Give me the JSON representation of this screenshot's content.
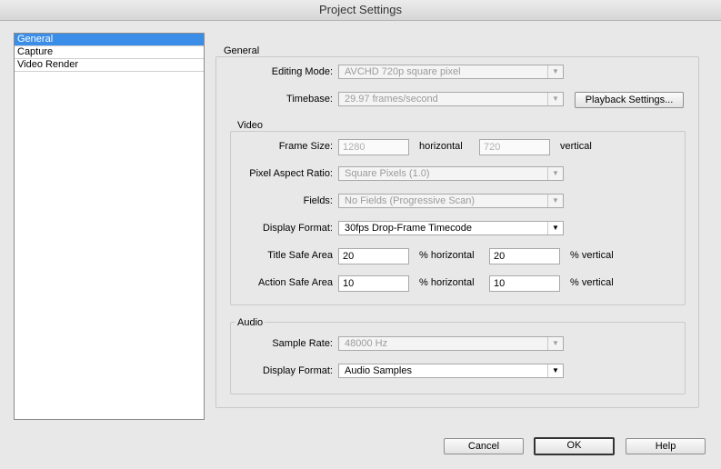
{
  "window": {
    "title": "Project Settings"
  },
  "sidebar": {
    "items": [
      "General",
      "Capture",
      "Video Render"
    ]
  },
  "general": {
    "group_label": "General",
    "editing_mode_label": "Editing Mode:",
    "editing_mode_value": "AVCHD 720p square pixel",
    "timebase_label": "Timebase:",
    "timebase_value": "29.97 frames/second",
    "playback_settings": "Playback Settings..."
  },
  "video": {
    "group_label": "Video",
    "frame_size_label": "Frame Size:",
    "frame_width": "1280",
    "horizontal_label": "horizontal",
    "frame_height": "720",
    "vertical_label": "vertical",
    "pixel_aspect_label": "Pixel Aspect Ratio:",
    "pixel_aspect_value": "Square Pixels (1.0)",
    "fields_label": "Fields:",
    "fields_value": "No Fields (Progressive Scan)",
    "display_format_label": "Display Format:",
    "display_format_value": "30fps Drop-Frame Timecode",
    "title_safe_label": "Title Safe Area",
    "title_safe_h": "20",
    "pct_horizontal": "% horizontal",
    "title_safe_v": "20",
    "pct_vertical": "% vertical",
    "action_safe_label": "Action Safe Area",
    "action_safe_h": "10",
    "action_safe_v": "10"
  },
  "audio": {
    "group_label": "Audio",
    "sample_rate_label": "Sample Rate:",
    "sample_rate_value": "48000 Hz",
    "display_format_label": "Display Format:",
    "display_format_value": "Audio Samples"
  },
  "buttons": {
    "cancel": "Cancel",
    "ok": "OK",
    "help": "Help"
  }
}
